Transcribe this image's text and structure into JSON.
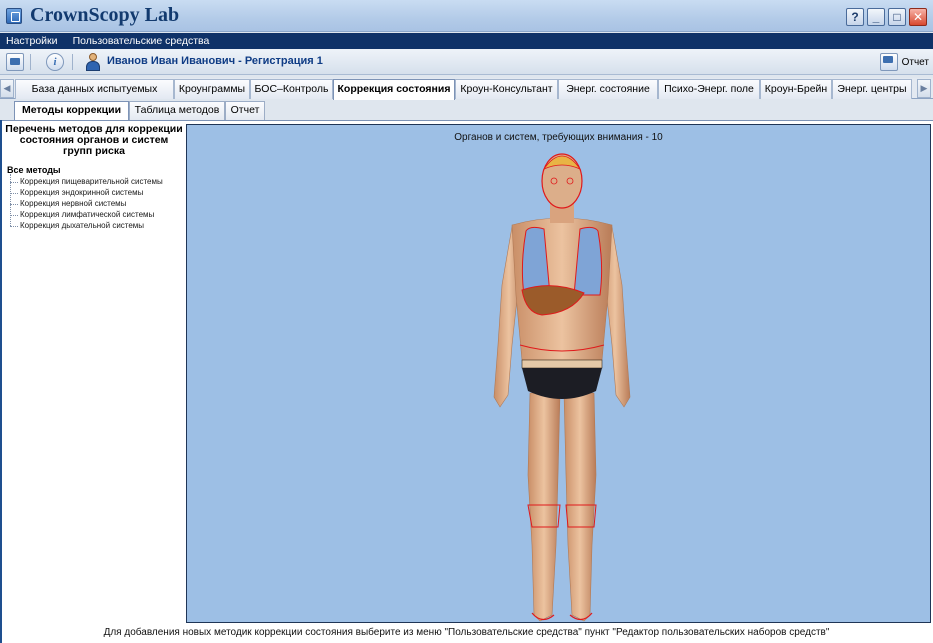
{
  "window": {
    "title": "CrownScopy Lab",
    "buttons": [
      "?",
      "_",
      "□",
      "✕"
    ]
  },
  "menu": [
    "Настройки",
    "Пользовательские средства"
  ],
  "toolbar": {
    "user_name": "Иванов Иван Иванович - Регистрация 1",
    "report_label": "Отчет"
  },
  "main_tabs": [
    {
      "label": "База данных испытуемых",
      "active": false
    },
    {
      "label": "Кроунграммы",
      "active": false
    },
    {
      "label": "БОС–Контроль",
      "active": false
    },
    {
      "label": "Коррекция состояния",
      "active": true
    },
    {
      "label": "Кроун-Консультант",
      "active": false
    },
    {
      "label": "Энерг. состояние",
      "active": false
    },
    {
      "label": "Психо-Энерг. поле",
      "active": false
    },
    {
      "label": "Кроун-Брейн",
      "active": false
    },
    {
      "label": "Энерг. центры",
      "active": false
    }
  ],
  "sub_tabs": [
    {
      "label": "Методы коррекции",
      "active": true
    },
    {
      "label": "Таблица методов",
      "active": false
    },
    {
      "label": "Отчет",
      "active": false
    }
  ],
  "left_panel": {
    "title": "Перечень методов для коррекции состояния органов и систем групп риска",
    "root": "Все методы",
    "items": [
      "Коррекция пищеварительной системы",
      "Коррекция эндокринной системы",
      "Коррекция нервной системы",
      "Коррекция лимфатической системы",
      "Коррекция дыхательной системы"
    ]
  },
  "body_panel": {
    "caption": "Органов и систем, требующих внимания - 10",
    "highlight_color": "#e0191b",
    "background_color": "#9dbfe5"
  },
  "footer": {
    "note": "Для добавления новых методик коррекции состояния выберите из меню \"Пользовательские средства\" пункт \"Редактор пользовательских наборов средств\""
  }
}
